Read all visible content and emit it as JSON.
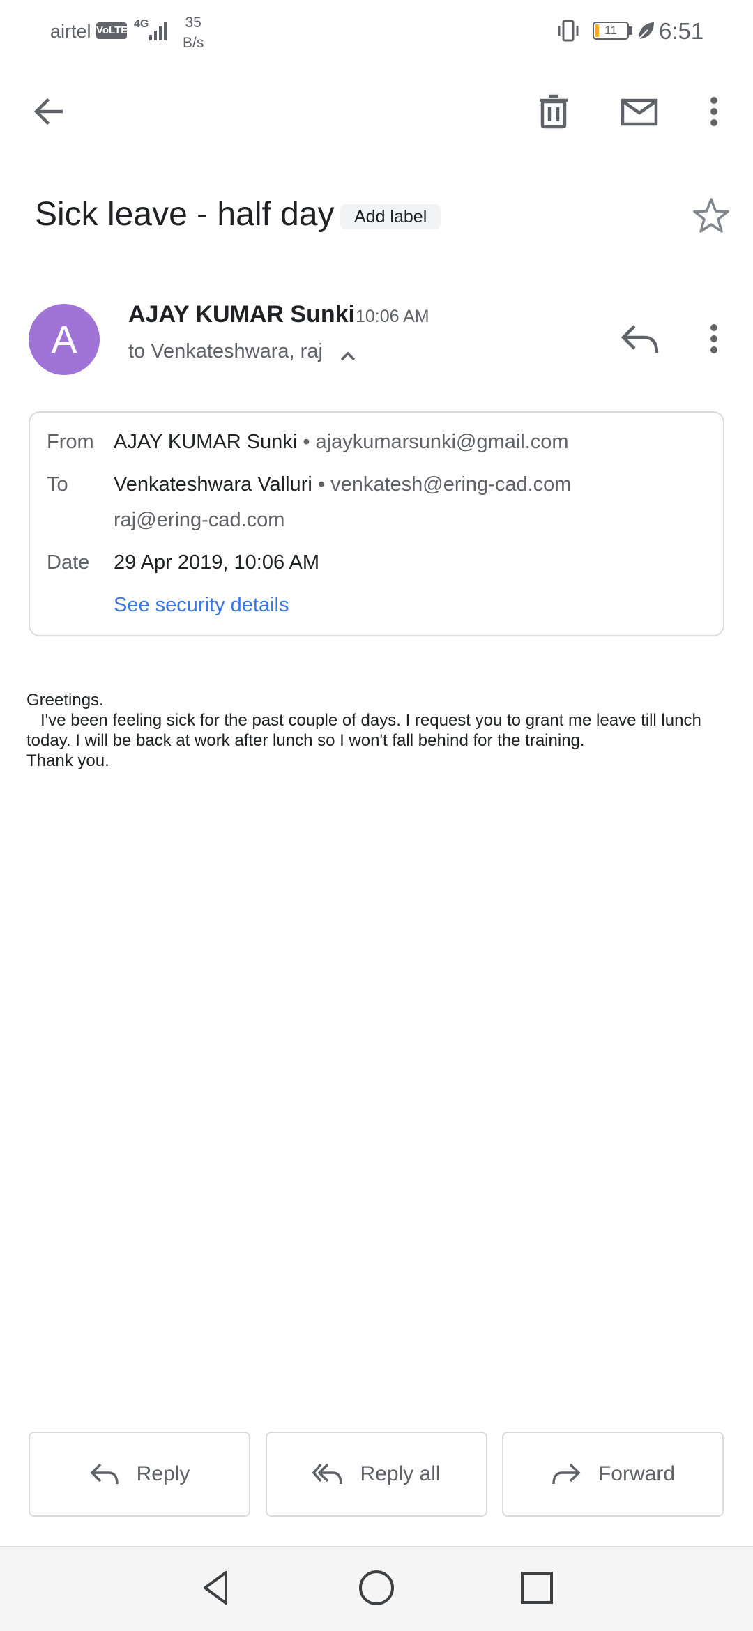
{
  "status_bar": {
    "carrier": "airtel",
    "volte": "VoLTE",
    "network": "4G",
    "speed_value": "35",
    "speed_unit": "B/s",
    "battery": "11",
    "battery_level_pct": 11,
    "time": "6:51"
  },
  "toolbar": {
    "back_icon": "arrow-back-icon",
    "delete_icon": "trash-icon",
    "mark_unread_icon": "mail-icon",
    "more_icon": "more-vert-icon"
  },
  "subject": {
    "title": "Sick leave - half day",
    "add_label": "Add label",
    "star_icon": "star-outline-icon"
  },
  "message": {
    "avatar_letter": "A",
    "avatar_color": "#a074d6",
    "sender": "AJAY KUMAR Sunki",
    "time": "10:06 AM",
    "recipients": "to Venkateshwara, raj"
  },
  "details": {
    "from_label": "From",
    "from_name": "AJAY KUMAR Sunki",
    "from_email": "• ajaykumarsunki@gmail.com",
    "to_label": "To",
    "to_name": "Venkateshwara Valluri",
    "to_email": "• venkatesh@ering-cad.com",
    "to_second": "raj@ering-cad.com",
    "date_label": "Date",
    "date_value": "29 Apr 2019, 10:06 AM",
    "security_link": "See security details",
    "link_color": "#3b78e7"
  },
  "body": {
    "text": "Greetings.\n   I've been feeling sick for the past couple of days. I request you to grant me leave till lunch today. I will be back at work after lunch so I won't fall behind for the training.\nThank you."
  },
  "actions": {
    "reply": "Reply",
    "reply_all": "Reply all",
    "forward": "Forward"
  }
}
